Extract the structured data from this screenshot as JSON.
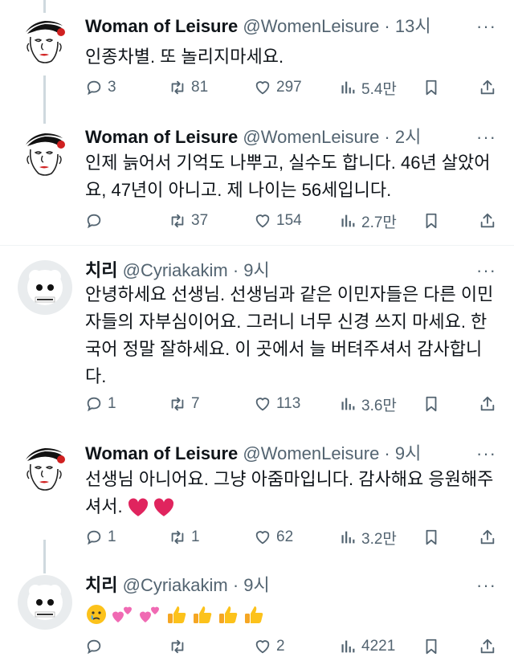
{
  "tweets": [
    {
      "name": "Woman of Leisure",
      "handle": "@WomenLeisure · 13시",
      "text": "인종차별. 또 놀리지마세요.",
      "replies": "3",
      "retweets": "81",
      "likes": "297",
      "views": "5.4만"
    },
    {
      "name": "Woman of Leisure",
      "handle": "@WomenLeisure · 2시",
      "text": "인제 늙어서 기억도 나뿌고, 실수도 합니다. 46년 살았어요, 47년이 아니고. 제 나이는 56세입니다.",
      "replies": "",
      "retweets": "37",
      "likes": "154",
      "views": "2.7만"
    },
    {
      "name": "치리",
      "handle": "@Cyriakakim · 9시",
      "text": "안녕하세요 선생님. 선생님과 같은 이민자들은 다른 이민자들의 자부심이어요. 그러니 너무 신경 쓰지 마세요. 한국어 정말 잘하세요. 이 곳에서 늘 버텨주셔서 감사합니다.",
      "replies": "1",
      "retweets": "7",
      "likes": "113",
      "views": "3.6만"
    },
    {
      "name": "Woman of Leisure",
      "handle": "@WomenLeisure · 9시",
      "text": "선생님 아니어요. 그냥 아줌마입니다. 감사해요 응원해주셔서.",
      "replies": "1",
      "retweets": "1",
      "likes": "62",
      "views": "3.2만"
    },
    {
      "name": "치리",
      "handle": "@Cyriakakim · 9시",
      "text": "",
      "replies": "",
      "retweets": "",
      "likes": "2",
      "views": "4221"
    }
  ],
  "more_glyph": "···",
  "icons": [
    "reply-icon",
    "retweet-icon",
    "like-icon",
    "views-icon",
    "bookmark-icon",
    "share-icon"
  ],
  "colors": {
    "text": "#0f1419",
    "muted": "#536471",
    "divider": "#eff3f4",
    "thread": "#cfd9de",
    "heart": "#e0245e"
  }
}
